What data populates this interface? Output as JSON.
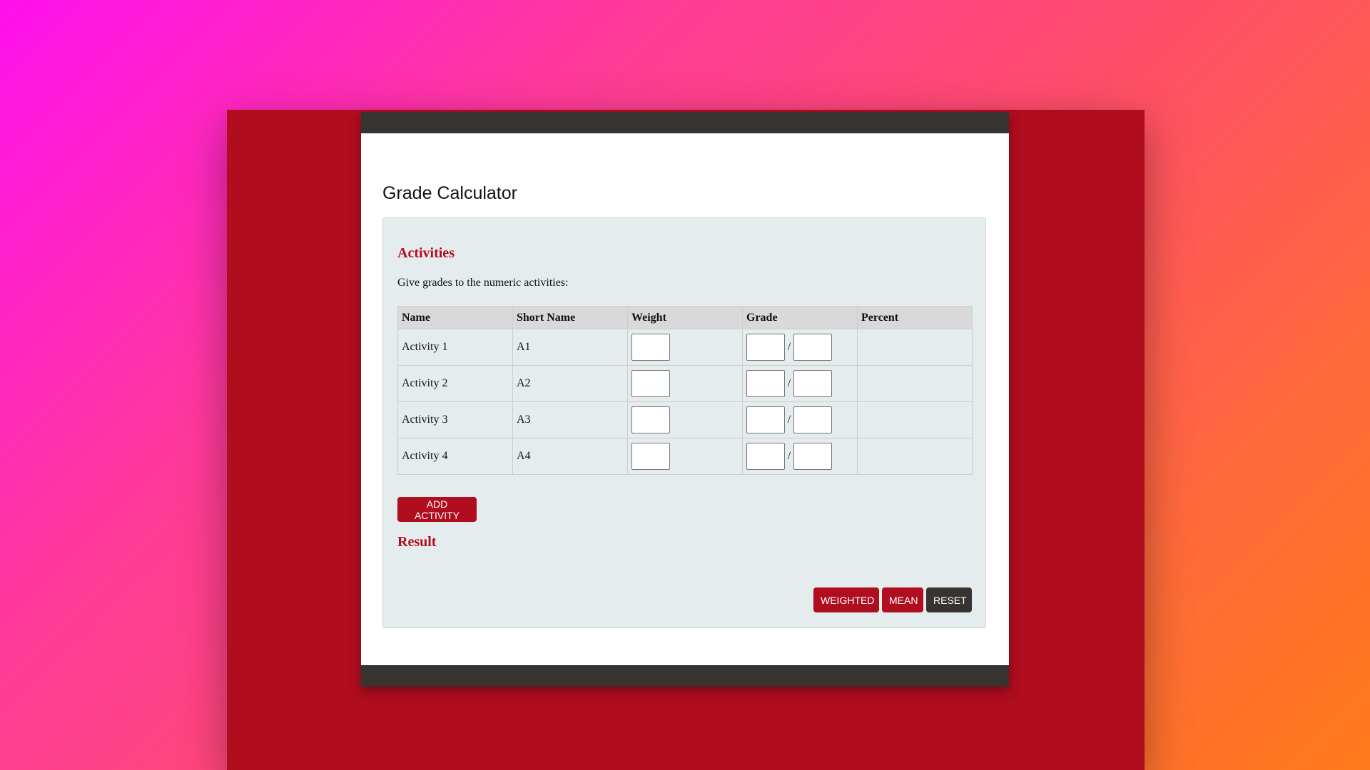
{
  "page": {
    "title": "Grade Calculator"
  },
  "activities": {
    "title": "Activities",
    "instructions": "Give grades to the numeric activities:",
    "columns": [
      "Name",
      "Short Name",
      "Weight",
      "Grade",
      "Percent"
    ],
    "rows": [
      {
        "name": "Activity 1",
        "short_name": "A1",
        "weight": "",
        "grade_earned": "",
        "grade_max": "",
        "percent": ""
      },
      {
        "name": "Activity 2",
        "short_name": "A2",
        "weight": "",
        "grade_earned": "",
        "grade_max": "",
        "percent": ""
      },
      {
        "name": "Activity 3",
        "short_name": "A3",
        "weight": "",
        "grade_earned": "",
        "grade_max": "",
        "percent": ""
      },
      {
        "name": "Activity 4",
        "short_name": "A4",
        "weight": "",
        "grade_earned": "",
        "grade_max": "",
        "percent": ""
      }
    ],
    "grade_separator": "/",
    "add_button_label": "ADD ACTIVITY"
  },
  "result": {
    "title": "Result",
    "weighted_label": "WEIGHTED",
    "mean_label": "MEAN",
    "reset_label": "RESET"
  },
  "colors": {
    "accent": "#b00d1f",
    "dark": "#363331",
    "panel": "#e5ecee"
  }
}
